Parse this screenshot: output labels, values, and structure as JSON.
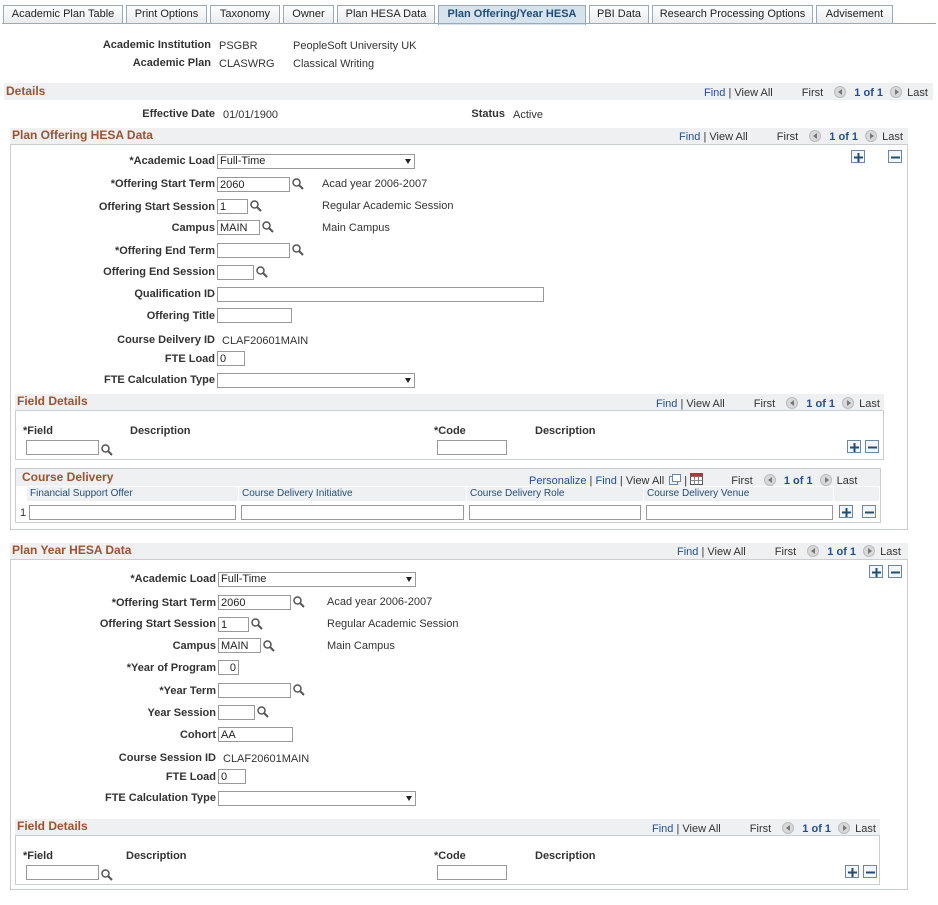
{
  "tabs": [
    "Academic Plan Table",
    "Print Options",
    "Taxonomy",
    "Owner",
    "Plan HESA Data",
    "Plan Offering/Year HESA",
    "PBI Data",
    "Research Processing Options",
    "Advisement"
  ],
  "header": {
    "institution_label": "Academic Institution",
    "institution_code": "PSGBR",
    "institution_desc": "PeopleSoft University UK",
    "plan_label": "Academic Plan",
    "plan_code": "CLASWRG",
    "plan_desc": "Classical Writing"
  },
  "details": {
    "title": "Details",
    "find": "Find",
    "view_all": "View All",
    "first": "First",
    "count": "1 of 1",
    "last": "Last",
    "eff_label": "Effective Date",
    "eff_value": "01/01/1900",
    "status_label": "Status",
    "status_value": "Active"
  },
  "offering": {
    "title": "Plan Offering HESA Data",
    "find": "Find",
    "view_all": "View All",
    "first": "First",
    "count": "1 of 1",
    "last": "Last",
    "acad_load_label": "*Academic Load",
    "acad_load_value": "Full-Time",
    "start_term_label": "*Offering Start Term",
    "start_term_value": "2060",
    "start_term_desc": "Acad year 2006-2007",
    "start_session_label": "Offering Start Session",
    "start_session_value": "1",
    "start_session_desc": "Regular Academic Session",
    "campus_label": "Campus",
    "campus_value": "MAIN",
    "campus_desc": "Main Campus",
    "end_term_label": "*Offering End Term",
    "end_term_value": "",
    "end_session_label": "Offering End Session",
    "end_session_value": "",
    "qual_label": "Qualification ID",
    "qual_value": "",
    "title_label": "Offering Title",
    "title_value": "",
    "delivery_label": "Course Deilvery ID",
    "delivery_value": "CLAF20601MAIN",
    "fte_label": "FTE Load",
    "fte_value": "0",
    "fte_calc_label": "FTE Calculation Type",
    "fte_calc_value": ""
  },
  "field_details_1": {
    "title": "Field Details",
    "find": "Find",
    "view_all": "View All",
    "first": "First",
    "count": "1 of 1",
    "last": "Last",
    "field_label": "*Field",
    "desc_label": "Description",
    "code_label": "*Code",
    "desc2_label": "Description"
  },
  "course_delivery": {
    "title": "Course Delivery",
    "personalize": "Personalize",
    "find": "Find",
    "view_all": "View All",
    "first": "First",
    "count": "1 of 1",
    "last": "Last",
    "columns": [
      "Financial Support Offer",
      "Course Delivery Initiative",
      "Course Delivery Role",
      "Course Delivery Venue"
    ],
    "row_num": "1"
  },
  "year": {
    "title": "Plan Year HESA Data",
    "find": "Find",
    "view_all": "View All",
    "first": "First",
    "count": "1 of 1",
    "last": "Last",
    "acad_load_label": "*Academic Load",
    "acad_load_value": "Full-Time",
    "start_term_label": "*Offering Start Term",
    "start_term_value": "2060",
    "start_term_desc": "Acad year 2006-2007",
    "start_session_label": "Offering Start Session",
    "start_session_value": "1",
    "start_session_desc": "Regular Academic Session",
    "campus_label": "Campus",
    "campus_value": "MAIN",
    "campus_desc": "Main Campus",
    "year_prog_label": "*Year of Program",
    "year_prog_value": "0",
    "year_term_label": "*Year Term",
    "year_term_value": "",
    "year_session_label": "Year Session",
    "year_session_value": "",
    "cohort_label": "Cohort",
    "cohort_value": "AA",
    "session_id_label": "Course Session ID",
    "session_id_value": "CLAF20601MAIN",
    "fte_label": "FTE Load",
    "fte_value": "0",
    "fte_calc_label": "FTE Calculation Type",
    "fte_calc_value": ""
  },
  "field_details_2": {
    "title": "Field Details",
    "find": "Find",
    "view_all": "View All",
    "first": "First",
    "count": "1 of 1",
    "last": "Last",
    "field_label": "*Field",
    "desc_label": "Description",
    "code_label": "*Code",
    "desc2_label": "Description"
  }
}
